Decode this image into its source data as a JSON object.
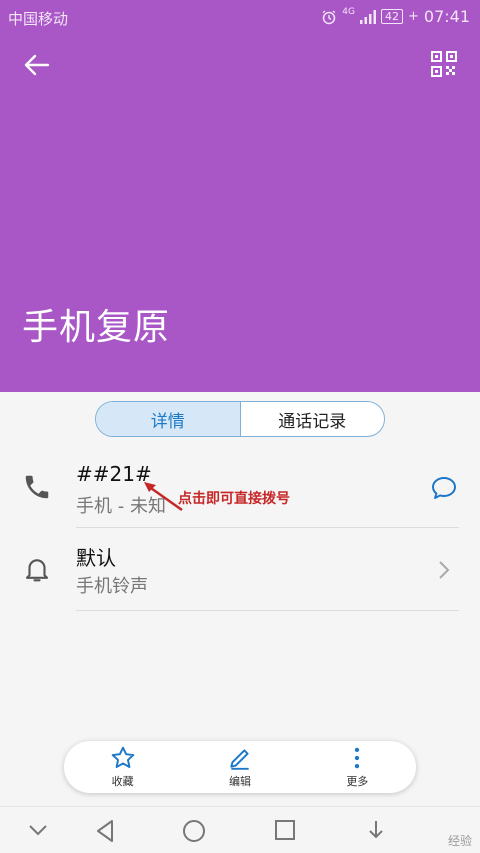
{
  "status": {
    "carrier": "中国移动",
    "network": "4G",
    "battery": "42",
    "time": "07:41"
  },
  "contact": {
    "name": "手机复原"
  },
  "tabs": [
    {
      "label": "详情",
      "active": true
    },
    {
      "label": "通话记录",
      "active": false
    }
  ],
  "phone_row": {
    "number": "##21#",
    "type": "手机 - 未知"
  },
  "ringtone_row": {
    "title": "默认",
    "subtitle": "手机铃声"
  },
  "annotation": "点击即可直接拨号",
  "actions": [
    {
      "label": "收藏",
      "icon": "star-icon"
    },
    {
      "label": "编辑",
      "icon": "pencil-icon"
    },
    {
      "label": "更多",
      "icon": "more-vert-icon"
    }
  ],
  "watermark": "经验",
  "colors": {
    "header": "#a956c6",
    "accent": "#1e78c8",
    "annotation": "#c62828"
  }
}
